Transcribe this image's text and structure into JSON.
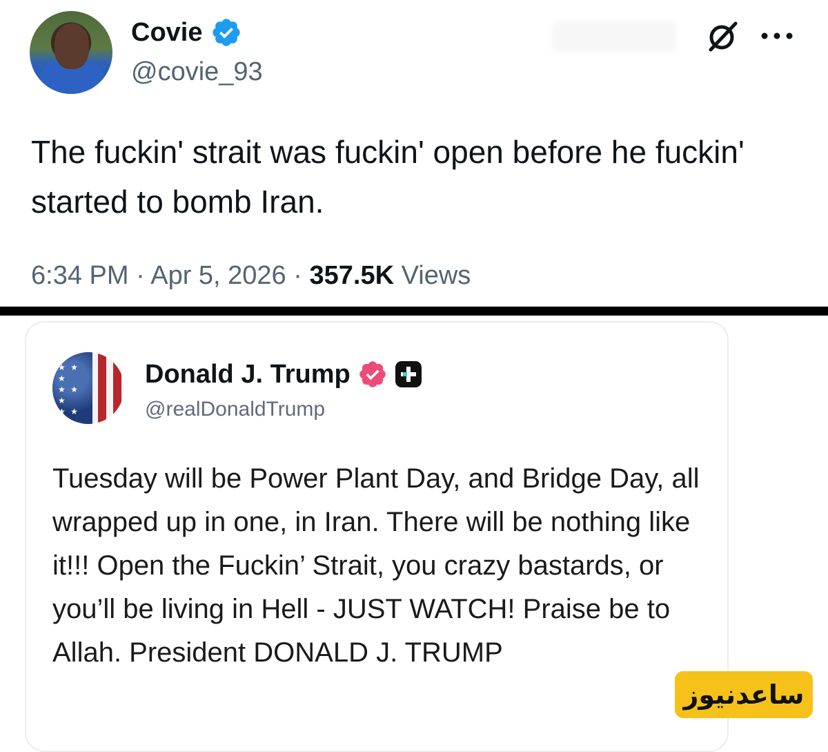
{
  "top_tweet": {
    "name": "Covie",
    "handle": "@covie_93",
    "text": "The fuckin' strait was fuckin' open before he fuckin' started to bomb Iran.",
    "time": "6:34 PM",
    "date": "Apr 5, 2026",
    "views_count": "357.5K",
    "views_label": "Views",
    "separator": "·",
    "icons": {
      "verified": "verified-badge-icon",
      "grok": "grok-icon",
      "more": "more-options-icon"
    },
    "colors": {
      "verified": "#1d9bf0",
      "secondary_text": "#536471"
    }
  },
  "truth_post": {
    "name": "Donald J. Trump",
    "handle": "@realDonaldTrump",
    "text": "Tuesday will be Power Plant Day, and Bridge Day, all wrapped up in one, in Iran. There will be nothing like it!!! Open the Fuckin’ Strait, you crazy bastards, or you’ll be living in Hell - JUST WATCH! Praise be to Allah. President DONALD J. TRUMP",
    "icons": {
      "verified": "verified-badge-icon",
      "plus": "plus-badge-icon"
    },
    "colors": {
      "verified": "#ec4b7a",
      "plus_badge": "#111111"
    }
  },
  "watermark": {
    "text": "ساعدنیوز",
    "color": "#f6c21a"
  }
}
